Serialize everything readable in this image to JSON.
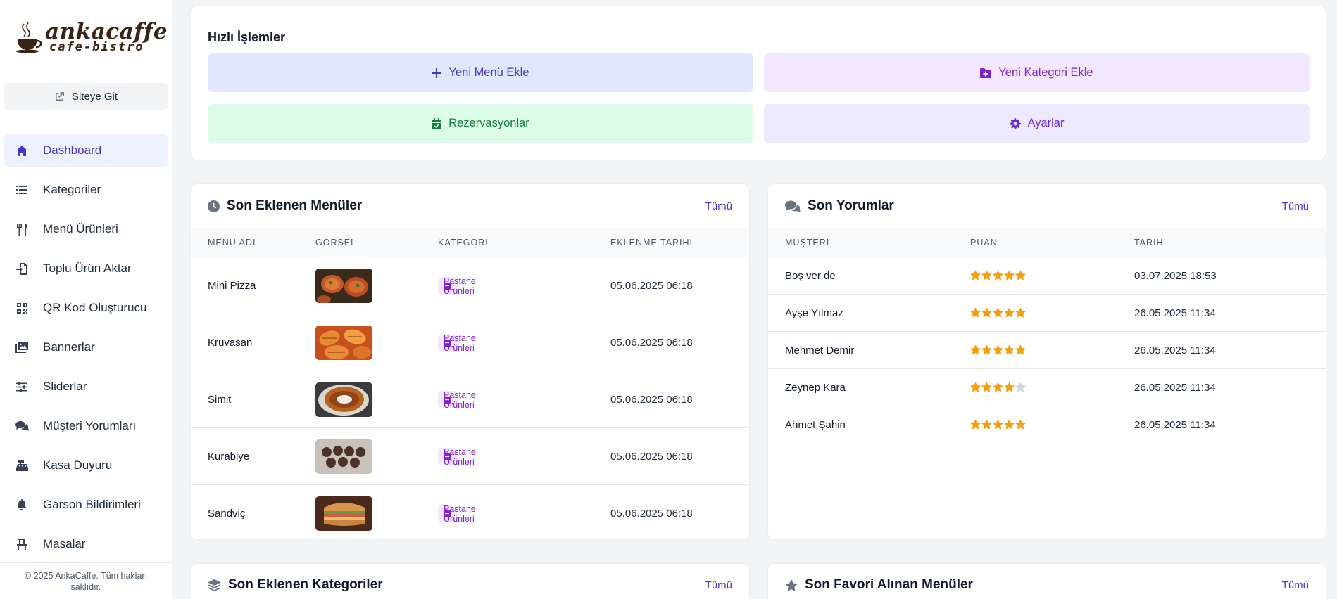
{
  "brand": {
    "name": "ankacaffe",
    "tagline": "cafe-bistro"
  },
  "sidebar": {
    "site_button": "Siteye Git",
    "items": [
      {
        "label": "Dashboard",
        "icon": "home-icon",
        "active": true
      },
      {
        "label": "Kategoriler",
        "icon": "list-icon"
      },
      {
        "label": "Menü Ürünleri",
        "icon": "utensils-icon"
      },
      {
        "label": "Toplu Ürün Aktar",
        "icon": "file-import-icon"
      },
      {
        "label": "QR Kod Oluşturucu",
        "icon": "qrcode-icon"
      },
      {
        "label": "Bannerlar",
        "icon": "images-icon"
      },
      {
        "label": "Sliderlar",
        "icon": "sliders-icon"
      },
      {
        "label": "Müşteri Yorumları",
        "icon": "comments-icon"
      },
      {
        "label": "Kasa Duyuru",
        "icon": "cash-register-icon"
      },
      {
        "label": "Garson Bildirimleri",
        "icon": "bell-icon"
      },
      {
        "label": "Masalar",
        "icon": "chair-icon"
      }
    ],
    "footer": "© 2025 AnkaCaffe. Tüm hakları saklıdır."
  },
  "quick_actions": {
    "title": "Hızlı İşlemler",
    "buttons": [
      {
        "label": "Yeni Menü Ekle",
        "icon": "plus-icon"
      },
      {
        "label": "Yeni Kategori Ekle",
        "icon": "folder-plus-icon"
      },
      {
        "label": "Rezervasyonlar",
        "icon": "calendar-icon"
      },
      {
        "label": "Ayarlar",
        "icon": "gear-icon"
      }
    ]
  },
  "recent_menus": {
    "title": "Son Eklenen Menüler",
    "all_link": "Tümü",
    "columns": [
      "MENÜ ADI",
      "GÖRSEL",
      "KATEGORİ",
      "EKLENME TARİHİ"
    ],
    "rows": [
      {
        "name": "Mini Pizza",
        "category": "Pastane Ürünleri",
        "date": "05.06.2025 06:18",
        "image": "mini-pizza-thumbnail"
      },
      {
        "name": "Kruvasan",
        "category": "Pastane Ürünleri",
        "date": "05.06.2025 06:18",
        "image": "croissant-thumbnail"
      },
      {
        "name": "Simit",
        "category": "Pastane Ürünleri",
        "date": "05.06.2025 06:18",
        "image": "simit-thumbnail"
      },
      {
        "name": "Kurabiye",
        "category": "Pastane Ürünleri",
        "date": "05.06.2025 06:18",
        "image": "cookie-thumbnail"
      },
      {
        "name": "Sandviç",
        "category": "Pastane Ürünleri",
        "date": "05.06.2025 06:18",
        "image": "sandwich-thumbnail"
      }
    ]
  },
  "recent_reviews": {
    "title": "Son Yorumlar",
    "all_link": "Tümü",
    "columns": [
      "MÜŞTERİ",
      "PUAN",
      "TARİH"
    ],
    "rows": [
      {
        "customer": "Boş ver de",
        "rating": 5,
        "date": "03.07.2025 18:53"
      },
      {
        "customer": "Ayşe Yılmaz",
        "rating": 5,
        "date": "26.05.2025 11:34"
      },
      {
        "customer": "Mehmet Demir",
        "rating": 5,
        "date": "26.05.2025 11:34"
      },
      {
        "customer": "Zeynep Kara",
        "rating": 4,
        "date": "26.05.2025 11:34"
      },
      {
        "customer": "Ahmet Şahin",
        "rating": 5,
        "date": "26.05.2025 11:34"
      }
    ]
  },
  "recent_categories": {
    "title": "Son Eklenen Kategoriler",
    "all_link": "Tümü"
  },
  "favorite_menus": {
    "title": "Son Favori Alınan Menüler",
    "all_link": "Tümü"
  },
  "colors": {
    "accent": "#4338ca",
    "star": "#f59e0b",
    "star_empty": "#d1d5db",
    "category_badge": "#7e22ce"
  }
}
